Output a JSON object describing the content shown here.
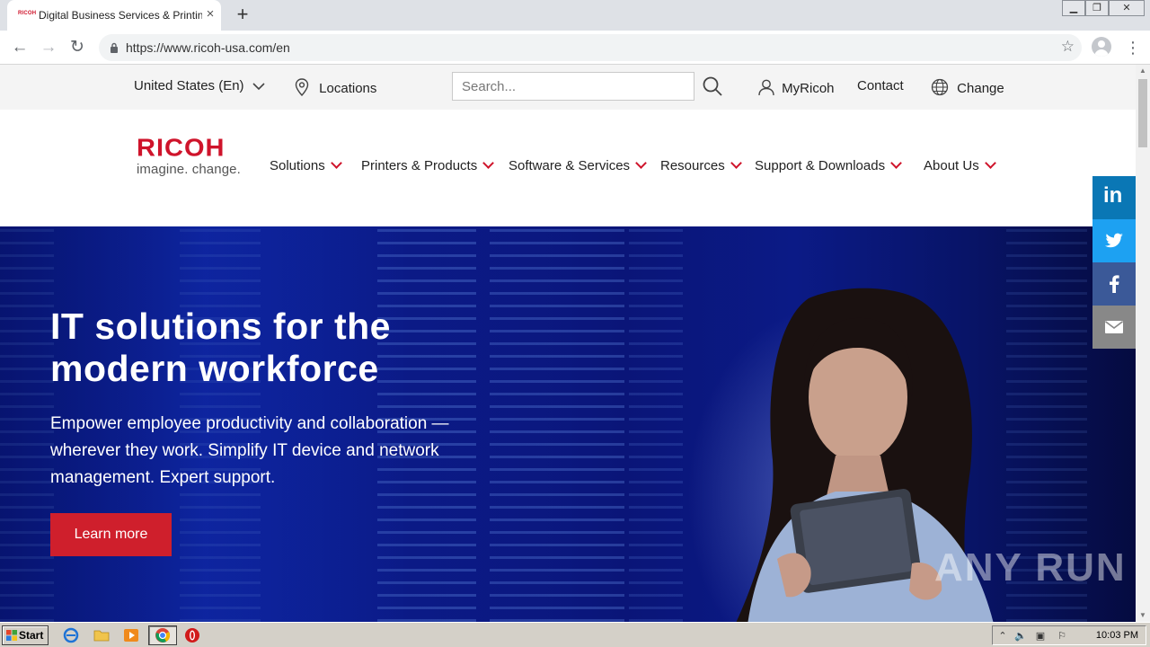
{
  "browser": {
    "tab_title": "Digital Business Services & Printing Solutions",
    "tab_favicon_text": "RICOH",
    "new_tab_symbol": "+",
    "url": "https://www.ricoh-usa.com/en"
  },
  "utility": {
    "country": "United States (En)",
    "locations": "Locations",
    "search_placeholder": "Search...",
    "myricoh": "MyRicoh",
    "contact": "Contact",
    "change": "Change"
  },
  "logo": {
    "wordmark": "RICOH",
    "tagline": "imagine. change."
  },
  "nav": {
    "items": [
      "Solutions",
      "Printers & Products",
      "Software & Services",
      "Resources",
      "Support & Downloads",
      "About Us"
    ]
  },
  "hero": {
    "title": "IT solutions for the modern workforce",
    "body": "Empower employee productivity and collaboration — wherever they work. Simplify IT device and network management. Expert support.",
    "cta": "Learn more"
  },
  "share": {
    "linkedin": "in"
  },
  "watermark": "ANY RUN",
  "taskbar": {
    "start": "Start",
    "clock": "10:03 PM"
  },
  "colors": {
    "brand_red": "#cf142b",
    "linkedin": "#0a77b5",
    "twitter": "#1da1f2",
    "facebook": "#3b5998",
    "email": "#888888"
  }
}
